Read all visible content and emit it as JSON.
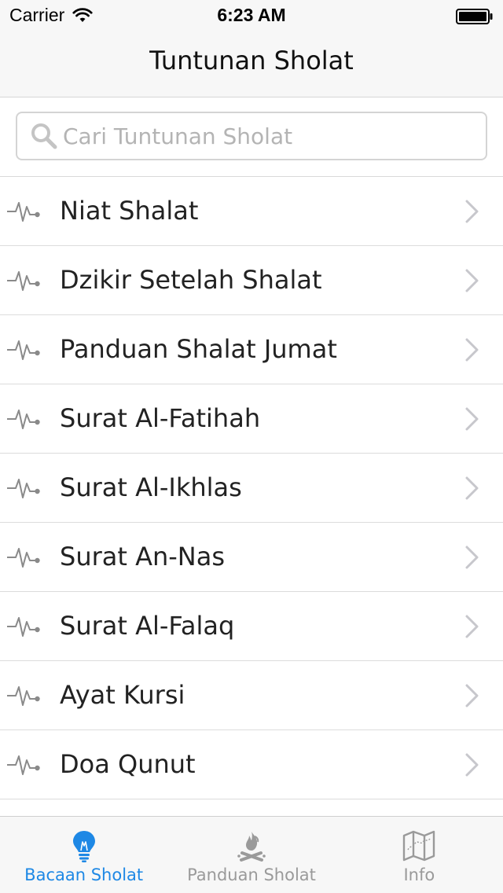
{
  "status_bar": {
    "carrier": "Carrier",
    "time": "6:23 AM"
  },
  "nav": {
    "title": "Tuntunan Sholat"
  },
  "search": {
    "placeholder": "Cari Tuntunan Sholat"
  },
  "list": {
    "items": [
      {
        "label": "Niat Shalat"
      },
      {
        "label": "Dzikir Setelah Shalat"
      },
      {
        "label": "Panduan Shalat Jumat"
      },
      {
        "label": "Surat Al-Fatihah"
      },
      {
        "label": "Surat Al-Ikhlas"
      },
      {
        "label": "Surat An-Nas"
      },
      {
        "label": "Surat Al-Falaq"
      },
      {
        "label": "Ayat Kursi"
      },
      {
        "label": "Doa Qunut"
      }
    ]
  },
  "tabbar": {
    "tabs": [
      {
        "label": "Bacaan Sholat",
        "icon": "lightbulb-icon",
        "active": true
      },
      {
        "label": "Panduan Sholat",
        "icon": "campfire-icon",
        "active": false
      },
      {
        "label": "Info",
        "icon": "map-icon",
        "active": false
      }
    ]
  },
  "colors": {
    "accent": "#1e88e5",
    "inactive": "#9a9a9a",
    "bar_background": "#f7f7f7",
    "separator": "#dcdcdc"
  }
}
